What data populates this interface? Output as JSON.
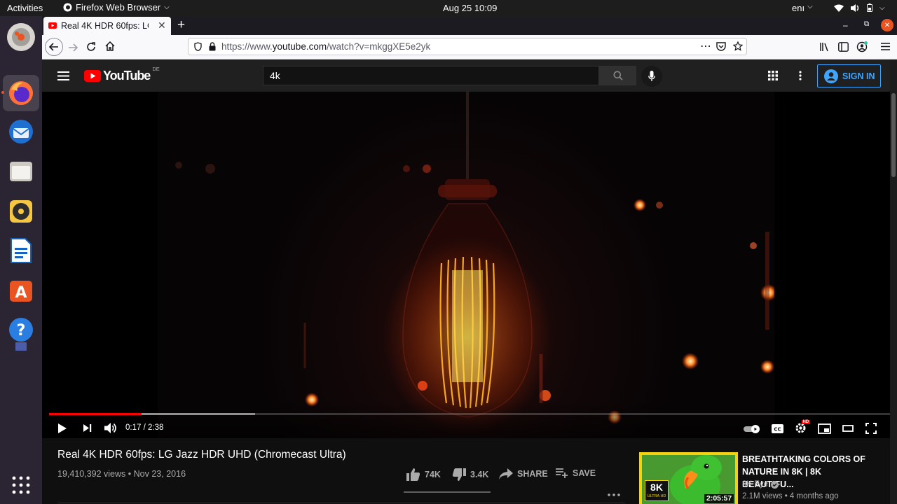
{
  "topbar": {
    "activities": "Activities",
    "app_name": "Firefox Web Browser",
    "datetime": "Aug 25  10:09",
    "lang": "enı"
  },
  "dock": {
    "items": [
      "files-icon",
      "firefox-icon",
      "thunderbird-icon",
      "folder-icon",
      "rhythmbox-icon",
      "writer-icon",
      "software-icon",
      "help-icon",
      "trash-icon",
      "app-grid-icon"
    ]
  },
  "browser": {
    "tab_title": "Real 4K HDR 60fps: LG Ja",
    "url_prefix": "https://www.",
    "url_domain": "youtube.com",
    "url_suffix": "/watch?v=mkggXE5e2yk"
  },
  "youtube": {
    "logo_text": "YouTube",
    "region": "DE",
    "search_value": "4k",
    "sign_in_label": "SIGN IN"
  },
  "player": {
    "time_current": "0:17",
    "time_separator": "/",
    "time_total": "2:38",
    "played_fraction": 0.11,
    "buffered_fraction": 0.245,
    "accent": "#ff0000",
    "settings_badge": "HD"
  },
  "video": {
    "title": "Real 4K HDR 60fps: LG Jazz HDR UHD (Chromecast Ultra)",
    "views": "19,410,392 views",
    "meta_separator": "•",
    "date": "Nov 23, 2016",
    "likes": "74K",
    "dislikes": "3.4K",
    "share_label": "SHARE",
    "save_label": "SAVE"
  },
  "recommended": {
    "title": "BREATHTAKING COLORS OF NATURE IN 8K | 8K BEAUTIFU...",
    "channel": "8K Eye",
    "stats": "2.1M views • 4 months ago",
    "duration": "2:05:57",
    "thumb_badge": "8K",
    "thumb_badge_sub": "ULTRA HD"
  }
}
